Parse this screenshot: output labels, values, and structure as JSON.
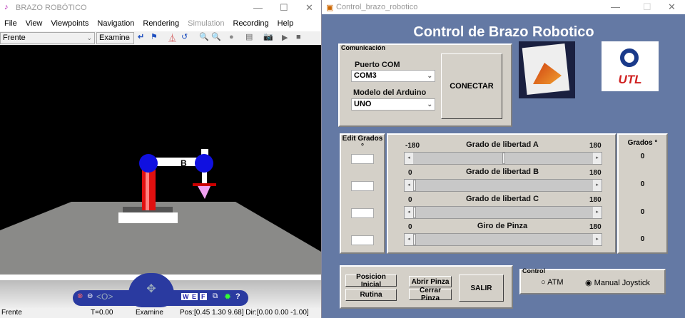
{
  "vr_window": {
    "title": "BRAZO ROBÓTICO",
    "menu": [
      "File",
      "View",
      "Viewpoints",
      "Navigation",
      "Rendering",
      "Simulation",
      "Recording",
      "Help"
    ],
    "viewpoint_select": "Frente",
    "nav_mode_select": "Examine",
    "robot_label": "B",
    "nav_buttons": [
      "W",
      "E",
      "F",
      "?"
    ],
    "status": {
      "viewpoint": "Frente",
      "time": "T=0.00",
      "mode": "Examine",
      "position": "Pos:[0.45 1.30 9.68] Dir:[0.00 0.00 -1.00]"
    }
  },
  "control_window": {
    "title": "Control_brazo_robotico",
    "heading": "Control de Brazo Robotico",
    "comm": {
      "legend": "Comunicación",
      "port_label": "Puerto COM",
      "port_value": "COM3",
      "model_label": "Modelo del Arduino",
      "model_value": "UNO",
      "connect": "CONECTAR"
    },
    "logos": {
      "matlab": "MATLAB",
      "utl": "UTL"
    },
    "edit_header": "Edit Grados °",
    "grados_header": "Grados °",
    "sliders": [
      {
        "label": "Grado de libertad A",
        "min": "-180",
        "max": "180",
        "value": 0,
        "display": "0"
      },
      {
        "label": "Grado de libertad B",
        "min": "0",
        "max": "180",
        "value": 0,
        "display": "0"
      },
      {
        "label": "Grado de libertad C",
        "min": "0",
        "max": "180",
        "value": 0,
        "display": "0"
      },
      {
        "label": "Giro de Pinza",
        "min": "0",
        "max": "180",
        "value": 0,
        "display": "0"
      }
    ],
    "buttons": {
      "posicion_inicial": "Posicion Inicial",
      "rutina": "Rutina",
      "abrir": "Abrir Pinza",
      "cerrar": "Cerrar Pinza",
      "salir": "SALIR"
    },
    "control": {
      "legend": "Control",
      "atm": "ATM",
      "manual": "Manual Joystick",
      "selected": "manual"
    }
  }
}
